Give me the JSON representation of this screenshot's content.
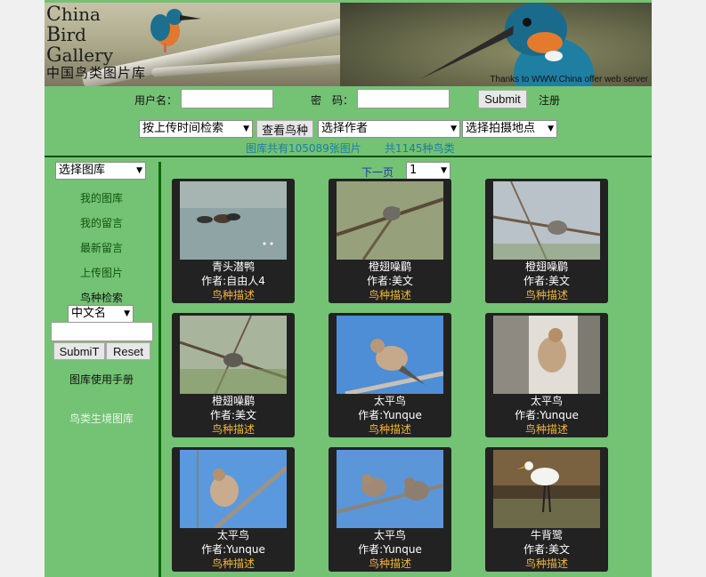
{
  "banner": {
    "title_c": "C",
    "title_c_rest": "hina",
    "title_b": "B",
    "title_b_rest": "ird",
    "title_g": "G",
    "title_g_rest": "allery",
    "subtitle": "中国鸟类图片库",
    "thanks": "Thanks to WWW.China offer web server"
  },
  "login": {
    "username_label": "用户名：",
    "password_label": "密　码：",
    "submit_label": "Submit",
    "register_label": "注册"
  },
  "filters": {
    "time_search": "按上传时间检索",
    "view_species": "查看鸟种",
    "author_select": "选择作者",
    "location_select": "选择拍摄地点"
  },
  "stats": {
    "images": "图库共有105089张图片",
    "species": "共1145种鸟类"
  },
  "sidebar": {
    "library_select": "选择图库",
    "my_gallery": "我的图库",
    "my_messages": "我的留言",
    "latest_messages": "最新留言",
    "upload": "上传图片",
    "species_search_label": "鸟种检索",
    "name_select": "中文名",
    "submit_label": "SubmiT",
    "reset_label": "Reset",
    "manual": "图库使用手册",
    "habitat": "鸟类生境图库"
  },
  "pager": {
    "next": "下一页",
    "page": "1"
  },
  "cards": [
    {
      "name": "青头潜鸭",
      "author": "作者:自由人4",
      "desc": "鸟种描述",
      "scene": "water"
    },
    {
      "name": "橙翅噪鹛",
      "author": "作者:美文",
      "desc": "鸟种描述",
      "scene": "branch"
    },
    {
      "name": "橙翅噪鹛",
      "author": "作者:美文",
      "desc": "鸟种描述",
      "scene": "branch2"
    },
    {
      "name": "橙翅噪鹛",
      "author": "作者:美文",
      "desc": "鸟种描述",
      "scene": "branch3"
    },
    {
      "name": "太平鸟",
      "author": "作者:Yunque",
      "desc": "鸟种描述",
      "scene": "sky"
    },
    {
      "name": "太平鸟",
      "author": "作者:Yunque",
      "desc": "鸟种描述",
      "scene": "tree"
    },
    {
      "name": "太平鸟",
      "author": "作者:Yunque",
      "desc": "鸟种描述",
      "scene": "sky2"
    },
    {
      "name": "太平鸟",
      "author": "作者:Yunque",
      "desc": "鸟种描述",
      "scene": "sky3"
    },
    {
      "name": "牛背鹭",
      "author": "作者:美文",
      "desc": "鸟种描述",
      "scene": "egret"
    }
  ]
}
